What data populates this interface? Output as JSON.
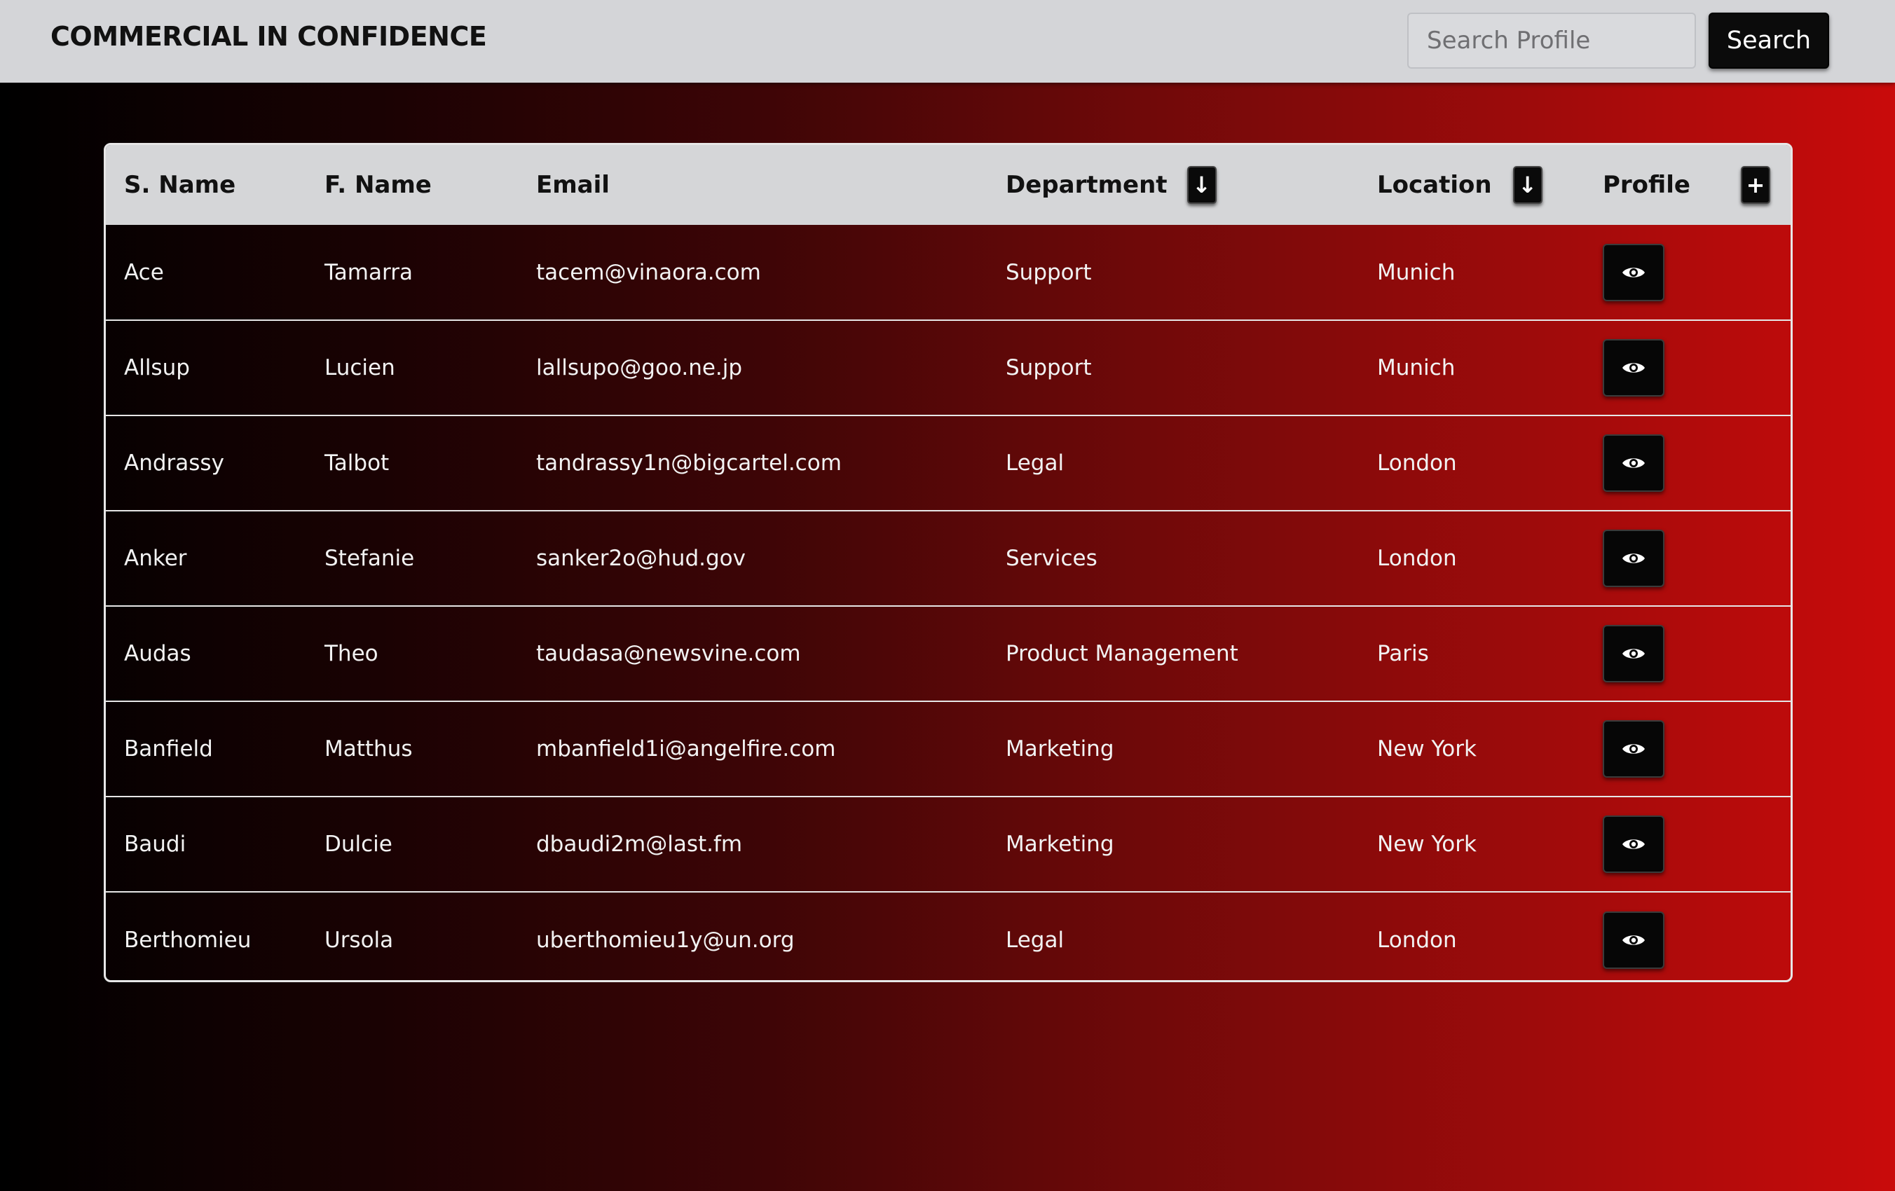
{
  "header": {
    "title": "COMMERCIAL IN CONFIDENCE",
    "search_placeholder": "Search Profile",
    "search_value": "",
    "search_button_label": "Search"
  },
  "table": {
    "columns": {
      "surname": "S. Name",
      "first_name": "F. Name",
      "email": "Email",
      "department": "Department",
      "location": "Location",
      "profile": "Profile"
    },
    "icons": {
      "department_sort": "arrow-down-icon",
      "location_sort": "arrow-down-icon",
      "add": "plus-icon",
      "view": "eye-icon"
    },
    "sort_glyph": "↓",
    "add_glyph": "+",
    "rows": [
      {
        "surname": "Ace",
        "first_name": "Tamarra",
        "email": "tacem@vinaora.com",
        "department": "Support",
        "location": "Munich"
      },
      {
        "surname": "Allsup",
        "first_name": "Lucien",
        "email": "lallsupo@goo.ne.jp",
        "department": "Support",
        "location": "Munich"
      },
      {
        "surname": "Andrassy",
        "first_name": "Talbot",
        "email": "tandrassy1n@bigcartel.com",
        "department": "Legal",
        "location": "London"
      },
      {
        "surname": "Anker",
        "first_name": "Stefanie",
        "email": "sanker2o@hud.gov",
        "department": "Services",
        "location": "London"
      },
      {
        "surname": "Audas",
        "first_name": "Theo",
        "email": "taudasa@newsvine.com",
        "department": "Product Management",
        "location": "Paris"
      },
      {
        "surname": "Banfield",
        "first_name": "Matthus",
        "email": "mbanfield1i@angelfire.com",
        "department": "Marketing",
        "location": "New York"
      },
      {
        "surname": "Baudi",
        "first_name": "Dulcie",
        "email": "dbaudi2m@last.fm",
        "department": "Marketing",
        "location": "New York"
      },
      {
        "surname": "Berthomieu",
        "first_name": "Ursola",
        "email": "uberthomieu1y@un.org",
        "department": "Legal",
        "location": "London"
      }
    ]
  }
}
